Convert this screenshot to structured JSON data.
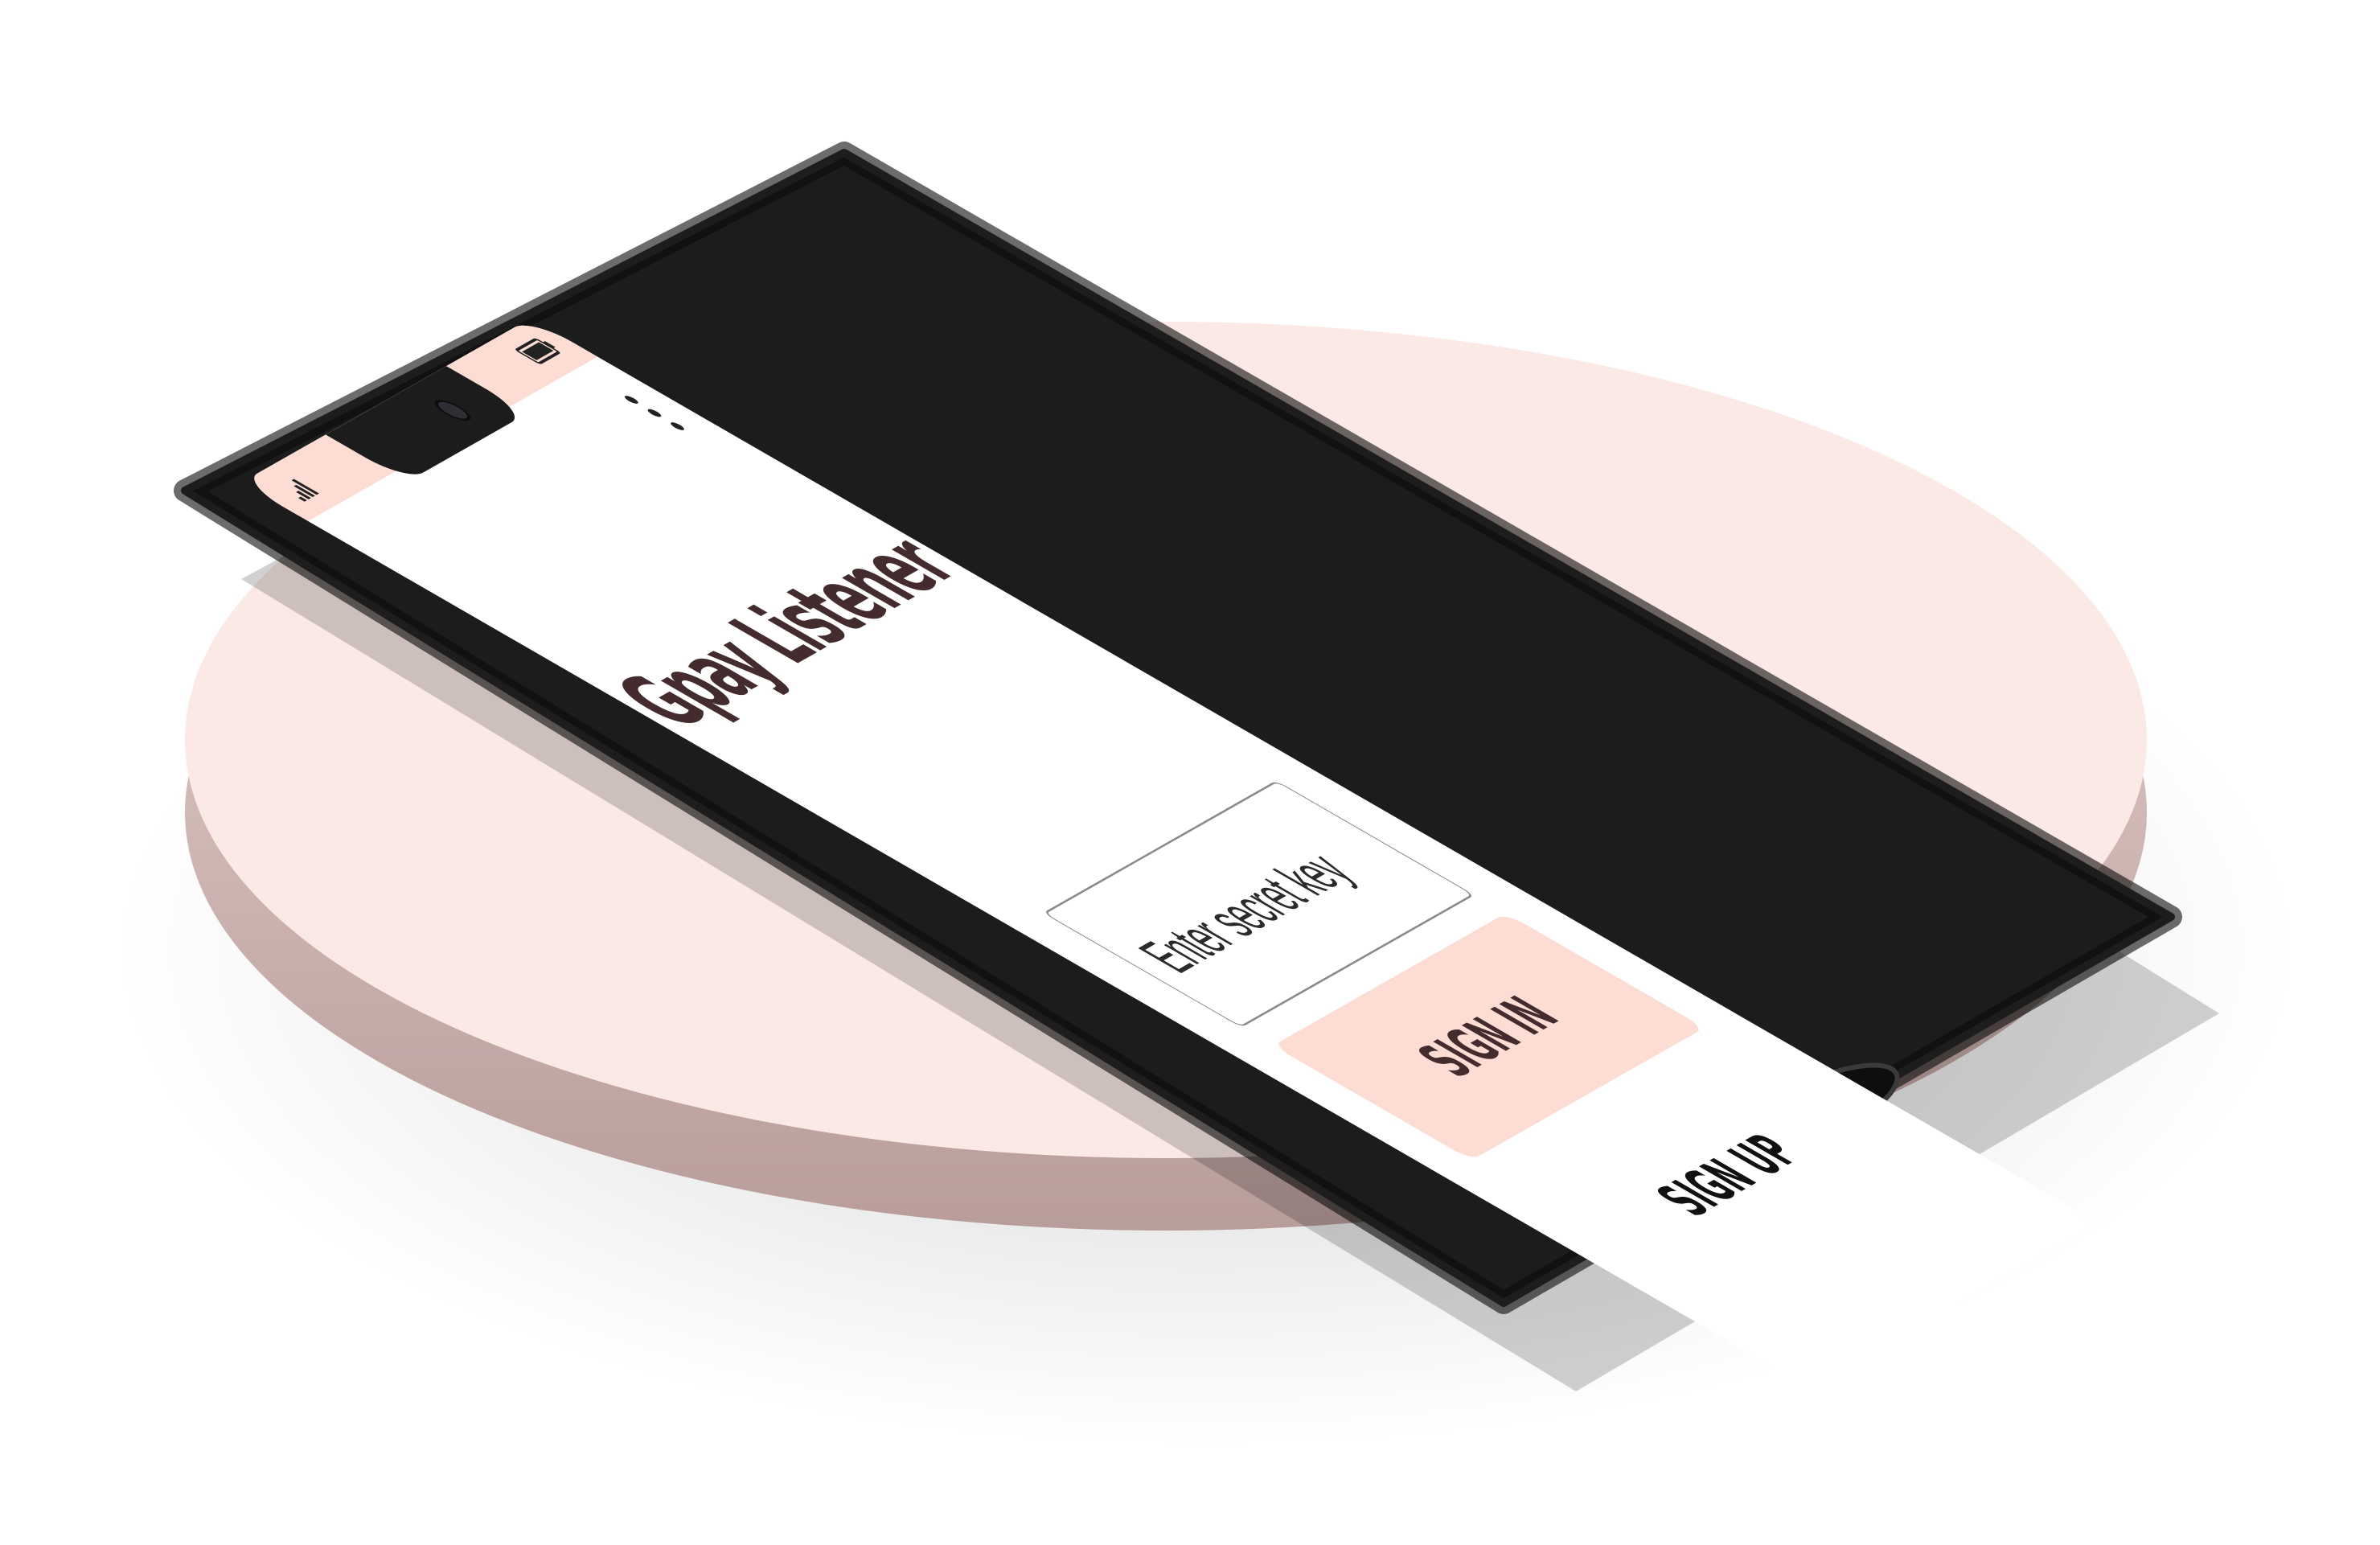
{
  "app": {
    "title": "Gpay Listener"
  },
  "status_bar": {
    "signal_icon": "signal-icon",
    "battery_icon": "battery-icon"
  },
  "toolbar": {
    "menu_icon": "more-vert-icon"
  },
  "form": {
    "secret_key": {
      "placeholder": "Enter secret key",
      "value": ""
    },
    "sign_in_label": "SIGN IN",
    "sign_up_label": "SIGN UP"
  },
  "colors": {
    "accent": "#fcdcd3",
    "title_text": "#442c2e",
    "platform": "#fbe9e6",
    "phone_body": "#1c1c1c"
  }
}
